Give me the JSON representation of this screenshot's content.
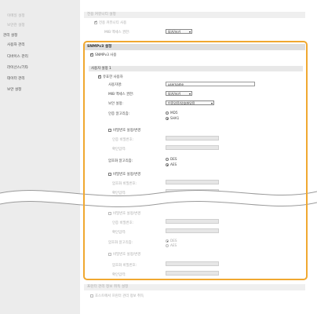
{
  "sidebar": {
    "items": [
      {
        "label": "이메일 설정"
      },
      {
        "label": "보안관 설정"
      },
      {
        "label": "관리 설정"
      },
      {
        "label": "사용자 관리"
      },
      {
        "label": "디바이스 관리"
      },
      {
        "label": "라이선스/기타"
      },
      {
        "label": "데이터 관리"
      },
      {
        "label": "보안 설정"
      }
    ]
  },
  "top": {
    "section_title": "전용 커뮤니티 설정",
    "checkbox_label": "전용 커뮤니티 사용",
    "mib_label": "MIB 액세스 권한:",
    "mib_value": "읽기/쓰기"
  },
  "snmpv3": {
    "title": "SNMPv3 설정",
    "use_label": "SNMPv3 사용",
    "user_section": "사용자 설정 1",
    "valid_user": "유효한 사용자",
    "username_label": "사용자명:",
    "username_value": "username",
    "mib_label": "MIB 액세스 권한:",
    "mib_value": "읽기/쓰기",
    "security_label": "보안 설정:",
    "security_value": "인증있음/암호화있음",
    "auth_algo_label": "인증 알고리즘:",
    "auth_options": [
      "MD5",
      "SHA1"
    ],
    "set_change_pw": "비밀번호 설정/변경",
    "auth_pw_label": "인증 비밀번호:",
    "confirm_label": "확인입력:",
    "enc_algo_label": "암호화 알고리즘:",
    "enc_options": [
      "DES",
      "AES"
    ],
    "set_change_pw2": "비밀번호 설정/변경",
    "enc_pw_label": "암호화 비밀번호:",
    "confirm_label2": "확인입력:"
  },
  "lower": {
    "set_change_pw": "비밀번호 설정/변경",
    "auth_pw_label": "인증 비밀번호:",
    "confirm_label": "확인입력:",
    "enc_algo_label": "암호화 알고리즘:",
    "enc_options": [
      "DES",
      "AES"
    ],
    "set_change_pw2": "비밀번호 설정/변경",
    "enc_pw_label": "암호화 비밀번호:",
    "confirm_label2": "확인입력:"
  },
  "bottom": {
    "section_title": "프린터 관리 정보 취득 설정",
    "checkbox_label": "호스트에서 프린터 관리 정보 취득"
  },
  "colors": {
    "highlight": "#f0a830",
    "section_bg": "#dedede",
    "sidebar_bg": "#ececec"
  }
}
